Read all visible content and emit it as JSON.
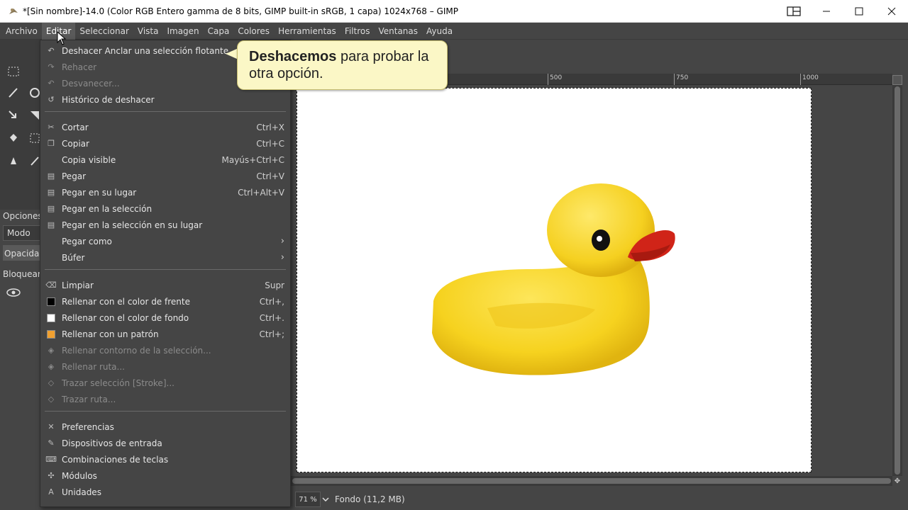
{
  "window": {
    "title": "*[Sin nombre]-14.0 (Color RGB Entero gamma de 8 bits, GIMP built-in sRGB, 1 capa) 1024x768 – GIMP"
  },
  "menubar": [
    "Archivo",
    "Editar",
    "Seleccionar",
    "Vista",
    "Imagen",
    "Capa",
    "Colores",
    "Herramientas",
    "Filtros",
    "Ventanas",
    "Ayuda"
  ],
  "edit_menu": {
    "items": [
      {
        "label": "Deshacer Anclar una selección flotante",
        "shortcut": "",
        "icon": "undo-icon",
        "disabled": false
      },
      {
        "label": "Rehacer",
        "shortcut": "",
        "icon": "redo-icon",
        "disabled": true
      },
      {
        "label": "Desvanecer...",
        "shortcut": "",
        "icon": "fade-icon",
        "disabled": true
      },
      {
        "label": "Histórico de deshacer",
        "shortcut": "",
        "icon": "history-icon",
        "disabled": false
      },
      {
        "label": "Cortar",
        "shortcut": "Ctrl+X",
        "icon": "scissors-icon",
        "disabled": false
      },
      {
        "label": "Copiar",
        "shortcut": "Ctrl+C",
        "icon": "copy-icon",
        "disabled": false
      },
      {
        "label": "Copia visible",
        "shortcut": "Mayús+Ctrl+C",
        "icon": "",
        "disabled": false
      },
      {
        "label": "Pegar",
        "shortcut": "Ctrl+V",
        "icon": "paste-icon",
        "disabled": false
      },
      {
        "label": "Pegar en su lugar",
        "shortcut": "Ctrl+Alt+V",
        "icon": "paste-in-place-icon",
        "disabled": false
      },
      {
        "label": "Pegar en la selección",
        "shortcut": "",
        "icon": "paste-into-icon",
        "disabled": false
      },
      {
        "label": "Pegar en la selección en su lugar",
        "shortcut": "",
        "icon": "paste-into-in-place-icon",
        "disabled": false
      },
      {
        "label": "Pegar como",
        "shortcut": "",
        "icon": "",
        "disabled": false,
        "submenu": true
      },
      {
        "label": "Búfer",
        "shortcut": "",
        "icon": "",
        "disabled": false,
        "submenu": true
      },
      {
        "label": "Limpiar",
        "shortcut": "Supr",
        "icon": "clear-icon",
        "disabled": false
      },
      {
        "label": "Rellenar con el color de frente",
        "shortcut": "Ctrl+,",
        "icon": "fg-swatch",
        "disabled": false
      },
      {
        "label": "Rellenar con el color de fondo",
        "shortcut": "Ctrl+.",
        "icon": "bg-swatch",
        "disabled": false
      },
      {
        "label": "Rellenar con un patrón",
        "shortcut": "Ctrl+;",
        "icon": "pattern-swatch",
        "disabled": false
      },
      {
        "label": "Rellenar contorno de la selección...",
        "shortcut": "",
        "icon": "fill-selection-icon",
        "disabled": true
      },
      {
        "label": "Rellenar ruta...",
        "shortcut": "",
        "icon": "fill-path-icon",
        "disabled": true
      },
      {
        "label": "Trazar selección [Stroke]...",
        "shortcut": "",
        "icon": "stroke-selection-icon",
        "disabled": true
      },
      {
        "label": "Trazar ruta...",
        "shortcut": "",
        "icon": "stroke-path-icon",
        "disabled": true
      },
      {
        "label": "Preferencias",
        "shortcut": "",
        "icon": "preferences-icon",
        "disabled": false
      },
      {
        "label": "Dispositivos de entrada",
        "shortcut": "",
        "icon": "input-devices-icon",
        "disabled": false
      },
      {
        "label": "Combinaciones de teclas",
        "shortcut": "",
        "icon": "keyboard-icon",
        "disabled": false
      },
      {
        "label": "Módulos",
        "shortcut": "",
        "icon": "modules-icon",
        "disabled": false
      },
      {
        "label": "Unidades",
        "shortcut": "",
        "icon": "units-icon",
        "disabled": false
      }
    ]
  },
  "callout": {
    "bold": "Deshacemos",
    "rest": " para probar la otra opción."
  },
  "ruler": {
    "ticks": [
      "500",
      "750",
      "1000"
    ]
  },
  "left_dock": {
    "options_tab": "Opciones",
    "mode_label": "Modo",
    "opacity_label": "Opacidad",
    "lock_label": "Bloquear"
  },
  "status": {
    "zoom": "71 %",
    "layer_info": "Fondo (11,2 MB)"
  },
  "colors": {
    "fg": "#000000",
    "bg": "#ffffff",
    "pattern": "#f0a030",
    "accent": "#f6d21f"
  }
}
